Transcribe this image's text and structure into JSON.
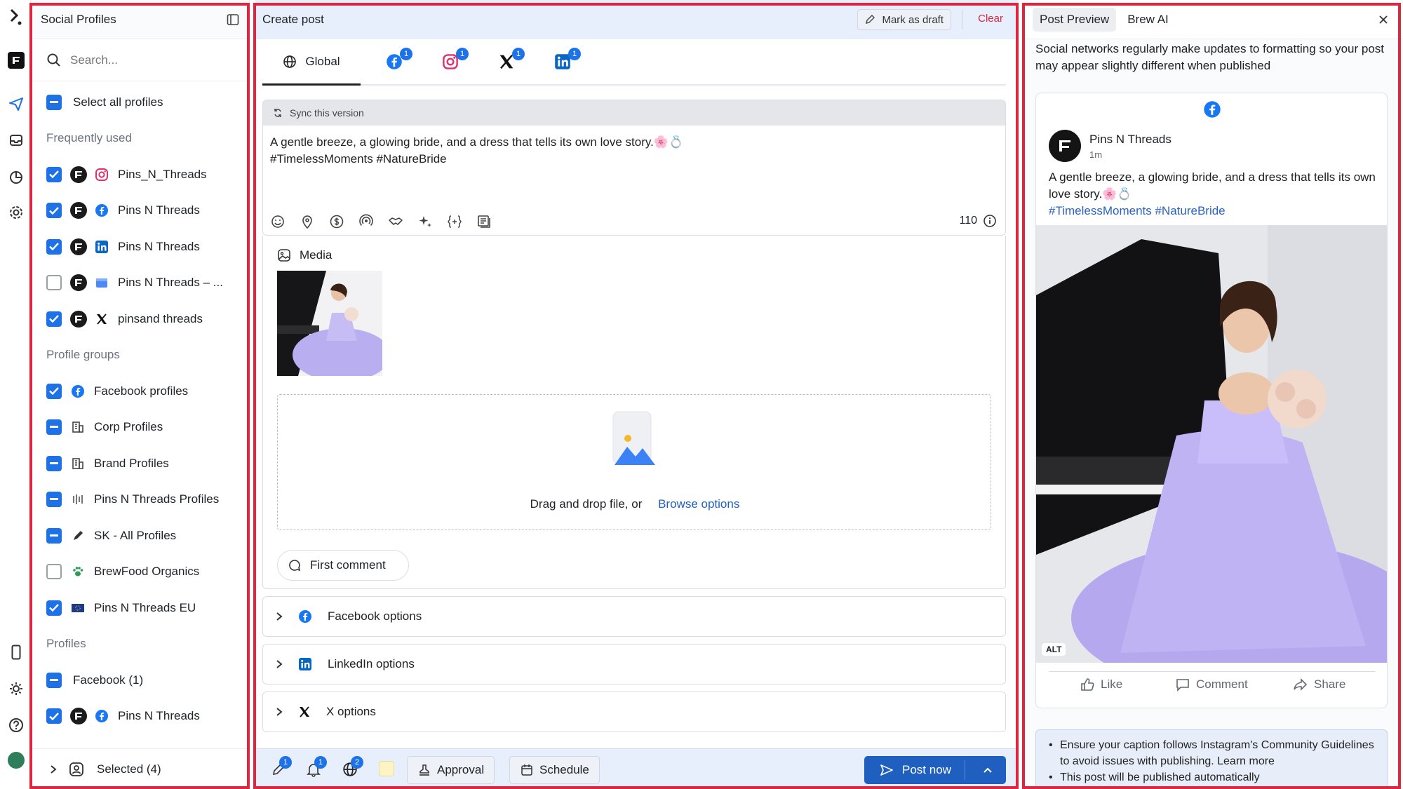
{
  "profiles_panel": {
    "title": "Social Profiles",
    "search_placeholder": "Search...",
    "select_all": "Select all profiles",
    "frequently_used_heading": "Frequently used",
    "frequently_used": [
      {
        "name": "Pins_N_Threads",
        "network": "instagram",
        "checked": true
      },
      {
        "name": "Pins N Threads",
        "network": "facebook",
        "checked": true
      },
      {
        "name": "Pins N Threads",
        "network": "linkedin",
        "checked": true
      },
      {
        "name": "Pins N Threads – ...",
        "network": "google-business",
        "checked": false
      },
      {
        "name": "pinsand threads",
        "network": "x",
        "checked": true
      }
    ],
    "groups_heading": "Profile groups",
    "groups": [
      {
        "name": "Facebook profiles",
        "icon": "facebook-icon",
        "state": "checked"
      },
      {
        "name": "Corp Profiles",
        "icon": "building-icon",
        "state": "partial"
      },
      {
        "name": "Brand Profiles",
        "icon": "building-icon",
        "state": "partial"
      },
      {
        "name": "Pins N Threads Profiles",
        "icon": "bars-icon",
        "state": "partial"
      },
      {
        "name": "SK - All Profiles",
        "icon": "pen-icon",
        "state": "partial"
      },
      {
        "name": "BrewFood Organics",
        "icon": "paw-icon",
        "state": "unchecked"
      },
      {
        "name": "Pins N Threads EU",
        "icon": "eu-flag-icon",
        "state": "checked"
      }
    ],
    "profiles_heading": "Profiles",
    "facebook_group_label": "Facebook (1)",
    "facebook_profile": "Pins N Threads",
    "footer_label": "Selected (4)"
  },
  "create_post": {
    "title": "Create post",
    "mark_draft": "Mark as draft",
    "clear": "Clear",
    "tab_global": "Global",
    "network_tabs": [
      {
        "network": "facebook",
        "badge": "1"
      },
      {
        "network": "instagram",
        "badge": "1"
      },
      {
        "network": "x",
        "badge": "1"
      },
      {
        "network": "linkedin",
        "badge": "1"
      }
    ],
    "sync_label": "Sync this version",
    "caption_line1": "A gentle breeze, a glowing bride, and a dress that tells its own love story.🌸💍",
    "caption_line2": "#TimelessMoments #NatureBride",
    "char_count": "110",
    "media_label": "Media",
    "drop_text": "Drag and drop file, or",
    "browse_link": "Browse options",
    "first_comment": "First comment",
    "options": [
      "Facebook options",
      "LinkedIn options",
      "X options"
    ],
    "footer": {
      "badge_edit": "1",
      "badge_bell": "1",
      "badge_globe": "2",
      "approval": "Approval",
      "schedule": "Schedule",
      "post_now": "Post now"
    }
  },
  "preview": {
    "tab_preview": "Post Preview",
    "tab_ai": "Brew AI",
    "note": "Social networks regularly make updates to formatting so your post may appear slightly different when published",
    "page_name": "Pins N Threads",
    "time": "1m",
    "caption": "A gentle breeze, a glowing bride, and a dress that tells its own love story.🌸💍",
    "hashtags": "#TimelessMoments #NatureBride",
    "alt_badge": "ALT",
    "like": "Like",
    "comment": "Comment",
    "share": "Share",
    "info_lines": [
      "Ensure your caption follows Instagram's Community Guidelines to avoid issues with publishing. Learn more",
      "This post will be published automatically"
    ]
  },
  "colors": {
    "accent": "#1d72e8",
    "highlight_border": "#e0263e",
    "header_bg": "#e7eefc",
    "facebook": "#1877f2",
    "linkedin": "#0a66c2",
    "instagram": "#e1306c",
    "post_now": "#1f5fbf"
  }
}
